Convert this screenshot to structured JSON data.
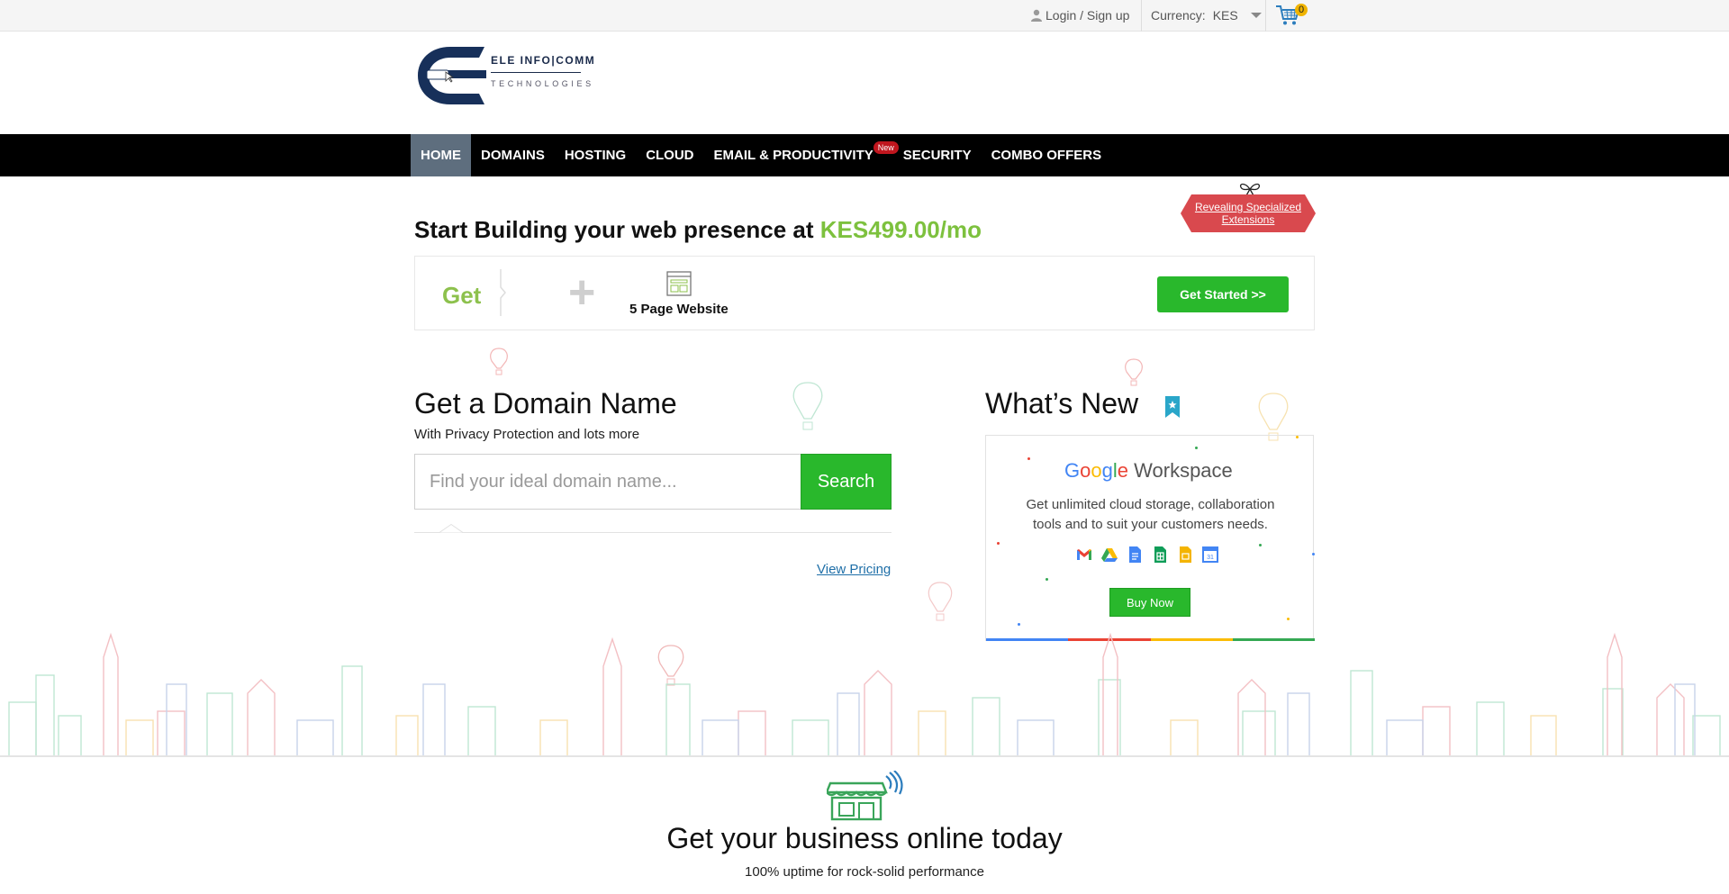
{
  "topbar": {
    "login_label": "Login / Sign up",
    "currency_label": "Currency:",
    "currency_value": "KES",
    "cart_count": "0"
  },
  "logo": {
    "name": "ELE INFO|COMM",
    "tagline": "TECHNOLOGIES"
  },
  "nav": {
    "items": [
      {
        "label": "HOME"
      },
      {
        "label": "DOMAINS"
      },
      {
        "label": "HOSTING"
      },
      {
        "label": "CLOUD"
      },
      {
        "label": "EMAIL & PRODUCTIVITY",
        "badge": "New"
      },
      {
        "label": "SECURITY"
      },
      {
        "label": "COMBO OFFERS"
      }
    ]
  },
  "promo": {
    "tag_label": "Revealing Specialized Extensions"
  },
  "hero": {
    "title_prefix": "Start Building your web presence at ",
    "price": "KES499.00/mo",
    "get_label": "Get",
    "plus": "+",
    "feature_label": "5 Page Website",
    "cta_label": "Get Started >>"
  },
  "domain": {
    "title": "Get a Domain Name",
    "subtitle": "With Privacy Protection and lots more",
    "placeholder": "Find your ideal domain name...",
    "search_label": "Search",
    "view_pricing": "View Pricing"
  },
  "whats_new": {
    "title": "What’s New",
    "product_google": [
      "G",
      "o",
      "o",
      "g",
      "l",
      "e"
    ],
    "product_suffix": "Workspace",
    "description": "Get unlimited cloud storage, collaboration tools and to suit your customers needs.",
    "buy_label": "Buy Now",
    "app_icons": [
      "gmail-icon",
      "drive-icon",
      "docs-icon",
      "sheets-icon",
      "slides-icon",
      "calendar-icon"
    ]
  },
  "business": {
    "title": "Get your business online today",
    "subtitle": "100% uptime for rock-solid performance"
  },
  "colors": {
    "accent_green": "#29b82c",
    "price_green": "#7dc13e",
    "nav_bg": "#000000",
    "nav_active": "#5e6e7e",
    "link_blue": "#1f6fa8",
    "promo_red": "#d9494e"
  }
}
